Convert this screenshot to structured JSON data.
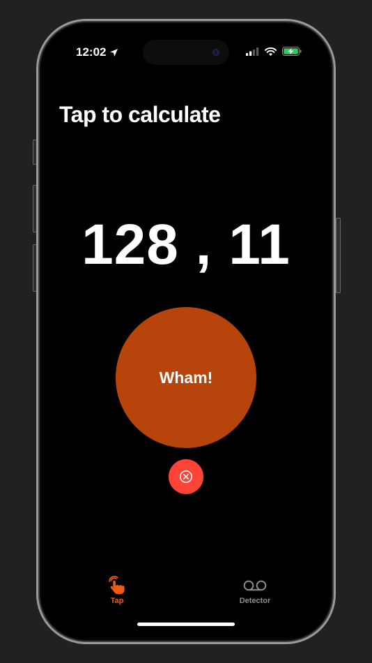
{
  "status_bar": {
    "time": "12:02",
    "location_icon": "location-arrow-icon",
    "signal_icon": "cellular-signal-icon",
    "wifi_icon": "wifi-icon",
    "battery_icon": "battery-charging-icon"
  },
  "page": {
    "title": "Tap to calculate",
    "result": "128 , 11"
  },
  "wham_button": {
    "label": "Wham!"
  },
  "clear_button": {
    "icon": "clear-circle-icon"
  },
  "tab_bar": {
    "tabs": [
      {
        "label": "Tap",
        "icon": "tap-hand-icon",
        "selected": true
      },
      {
        "label": "Detector",
        "icon": "voicemail-icon",
        "selected": false
      }
    ]
  },
  "colors": {
    "accent": "#f05a14",
    "wham": "#b7450b",
    "clear": "#ff4336",
    "inactive": "#8e8e93",
    "battery": "#34c759"
  }
}
